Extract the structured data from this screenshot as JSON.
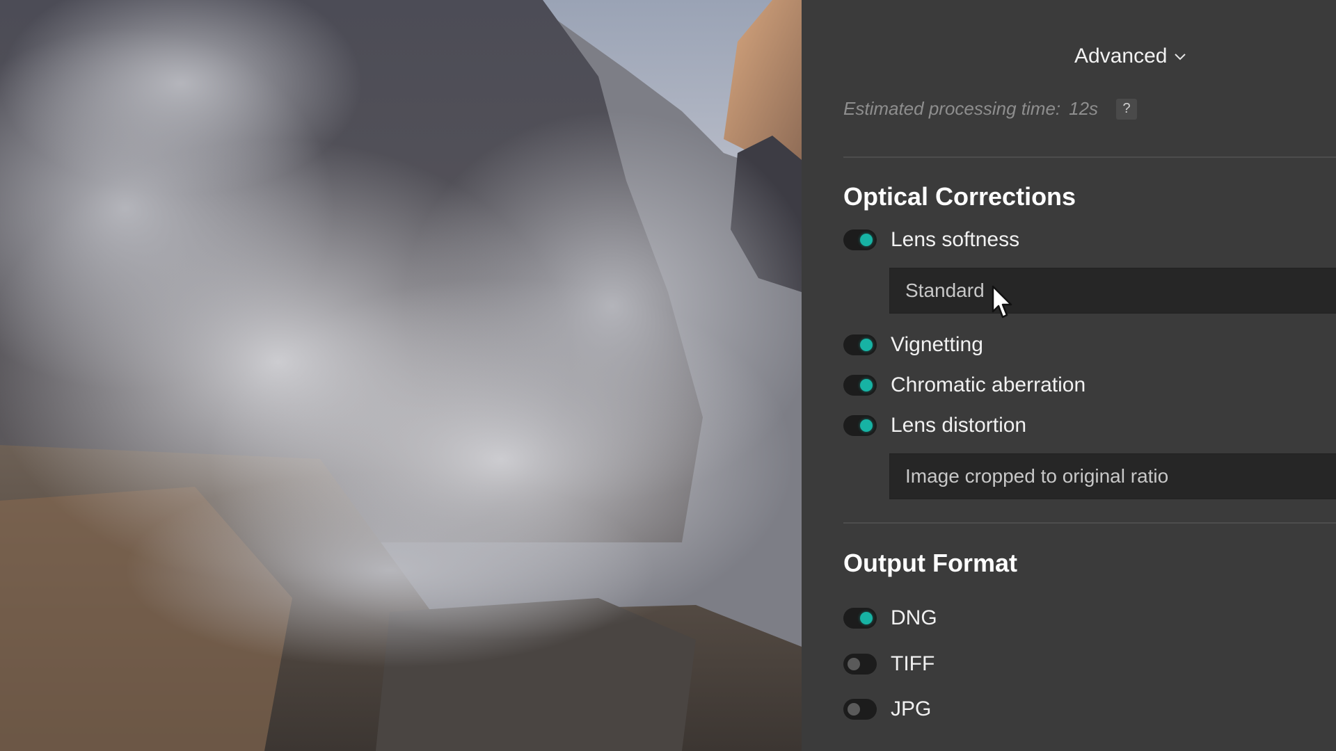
{
  "header": {
    "mode_label": "Advanced",
    "mode_icon": "chevron-down-icon"
  },
  "estimate": {
    "label": "Estimated processing time:",
    "value": "12s",
    "help_label": "?"
  },
  "optical": {
    "title": "Optical Corrections",
    "lens_softness": {
      "label": "Lens softness",
      "enabled": true
    },
    "softness_select": {
      "value": "Standard"
    },
    "vignetting": {
      "label": "Vignetting",
      "enabled": true
    },
    "chromatic": {
      "label": "Chromatic aberration",
      "enabled": true
    },
    "distortion": {
      "label": "Lens distortion",
      "enabled": true
    },
    "distortion_select": {
      "value": "Image cropped to original ratio"
    }
  },
  "output": {
    "title": "Output Format",
    "dng": {
      "label": "DNG",
      "enabled": true
    },
    "tiff": {
      "label": "TIFF",
      "enabled": false
    },
    "jpg": {
      "label": "JPG",
      "enabled": false
    }
  },
  "colors": {
    "panel_bg": "#3b3b3b",
    "accent": "#17b3a4",
    "toggle_track": "#1c1c1c",
    "muted_text": "#8e8e8e"
  }
}
